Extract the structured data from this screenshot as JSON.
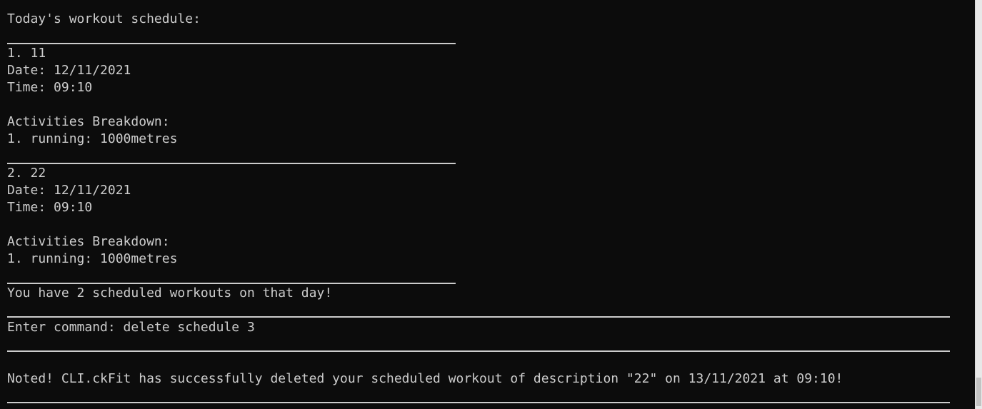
{
  "terminal": {
    "header": "Today's workout schedule:",
    "workouts": [
      {
        "title": "1. 11",
        "date": "Date: 12/11/2021",
        "time": "Time: 09:10",
        "breakdown_label": "Activities Breakdown:",
        "activity": "1. running: 1000metres"
      },
      {
        "title": "2. 22",
        "date": "Date: 12/11/2021",
        "time": "Time: 09:10",
        "breakdown_label": "Activities Breakdown:",
        "activity": "1. running: 1000metres"
      }
    ],
    "summary": "You have 2 scheduled workouts on that day!",
    "command_prompt": "Enter command: delete schedule 3",
    "message": "Noted! CLI.ckFit has successfully deleted your scheduled workout of description \"22\" on 13/11/2021 at 09:10!"
  },
  "colors": {
    "background": "#0c0c0c",
    "text": "#cccccc",
    "scrollbar": "#e8e8e8"
  }
}
